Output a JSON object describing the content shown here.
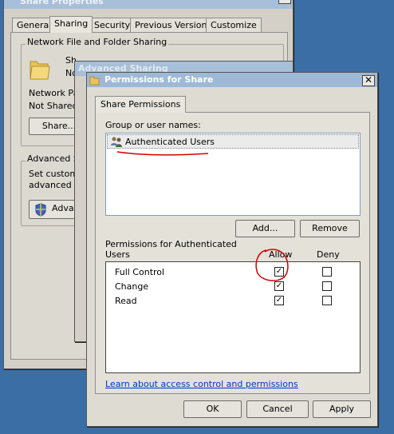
{
  "share_properties": {
    "title": "Share Properties",
    "tabs": [
      "General",
      "Sharing",
      "Security",
      "Previous Versions",
      "Customize"
    ],
    "network_sharing_group": "Network File and Folder Sharing",
    "share_name_partial": "Sh",
    "share_state_partial": "No",
    "network_path_partial": "Network Pa",
    "not_shared_label": "Not Shared",
    "share_button": "Share...",
    "advanced_group_partial": "Advanced S",
    "advanced_text_partial_1": "Set custom",
    "advanced_text_partial_2": "advanced s",
    "advanced_button_partial": "Adva"
  },
  "advanced_sharing": {
    "title": "Advanced Sharing"
  },
  "permissions_dialog": {
    "title": "Permissions for Share",
    "tab": "Share Permissions",
    "group_label": "Group or user names:",
    "users": [
      {
        "name": "Authenticated Users",
        "icon": "users-icon"
      }
    ],
    "add_button": "Add...",
    "remove_button": "Remove",
    "permissions_label_line1": "Permissions for Authenticated",
    "permissions_label_line2": "Users",
    "allow_header": "Allow",
    "deny_header": "Deny",
    "permissions": [
      {
        "name": "Full Control",
        "allow": true,
        "deny": false
      },
      {
        "name": "Change",
        "allow": true,
        "deny": false
      },
      {
        "name": "Read",
        "allow": true,
        "deny": false
      }
    ],
    "learn_link": "Learn about access control and permissions",
    "ok_button": "OK",
    "cancel_button": "Cancel",
    "apply_button": "Apply"
  },
  "colors": {
    "desktop": "#3a6ea5",
    "annotation": "#d00000",
    "link": "#0033cc"
  }
}
